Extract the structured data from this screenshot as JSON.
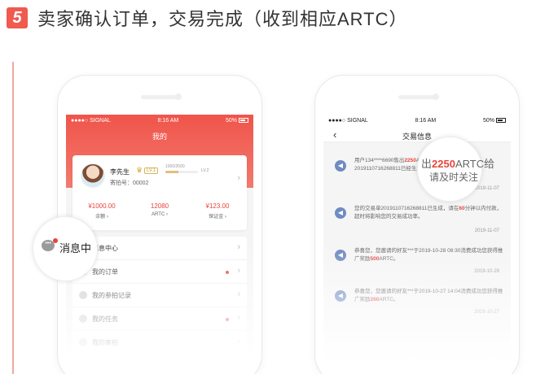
{
  "step": {
    "number": "5",
    "title": "卖家确认订单，交易完成（收到相应ARTC）"
  },
  "left_phone": {
    "status": {
      "carrier": "●●●●○ SIGNAL",
      "time": "8:16 AM",
      "battery": "50%"
    },
    "nav_title": "我的",
    "user": {
      "name": "李先生",
      "level": "LV.1",
      "progress_text": "1000/2500",
      "progress_fraction": 0.4,
      "next_level": "LV.2",
      "seller_no": "寄拍号：00002"
    },
    "stats": [
      {
        "value": "¥1000.00",
        "label": "余额 ›"
      },
      {
        "value": "12080",
        "label": "ARTC ›"
      },
      {
        "value": "¥123.00",
        "label": "保证金 ›"
      }
    ],
    "menu": [
      {
        "label": "消息中心"
      },
      {
        "label": "我的订单"
      },
      {
        "label": "我的参拍记录"
      },
      {
        "label": "我的任务"
      },
      {
        "label": "我的寄拍"
      }
    ],
    "zoom_text": "消息中"
  },
  "right_phone": {
    "status": {
      "carrier": "●●●●○ SIGNAL",
      "time": "8:16 AM",
      "battery": "50%"
    },
    "nav_title": "交易信息",
    "messages": [
      {
        "text_before": "用户134****6690售出",
        "highlight": "2250",
        "text_after": "ARTC给您，订单号2019110716268811已经生成，请及时关注。",
        "date": "2019-11-07"
      },
      {
        "text_before": "您的交易单2019110716268811已生成，请在",
        "highlight": "60",
        "text_after": "分钟以内付款，超时将影响您的交易成功率。",
        "date": "2019-11-07"
      },
      {
        "text_before": "恭喜您，您邀请的好友***于2019-10-28 08:30消费成功您获得推广奖励",
        "highlight": "500",
        "text_after": "ARTC。",
        "date": "2019-10-28"
      },
      {
        "text_before": "恭喜您，您邀请的好友***于2019-10-27 14:04消费成功您获得推广奖励",
        "highlight": "260",
        "text_after": "ARTC。",
        "date": "2019-10-27"
      }
    ],
    "zoom_line1": "出2250ARTC给",
    "zoom_line2": "请及时关注"
  },
  "colors": {
    "accent": "#f05a4f",
    "highlight": "#e8453c"
  },
  "icons": [
    "message-icon",
    "back-arrow-icon",
    "chevron-right-icon",
    "crown-icon",
    "notification-icon"
  ]
}
